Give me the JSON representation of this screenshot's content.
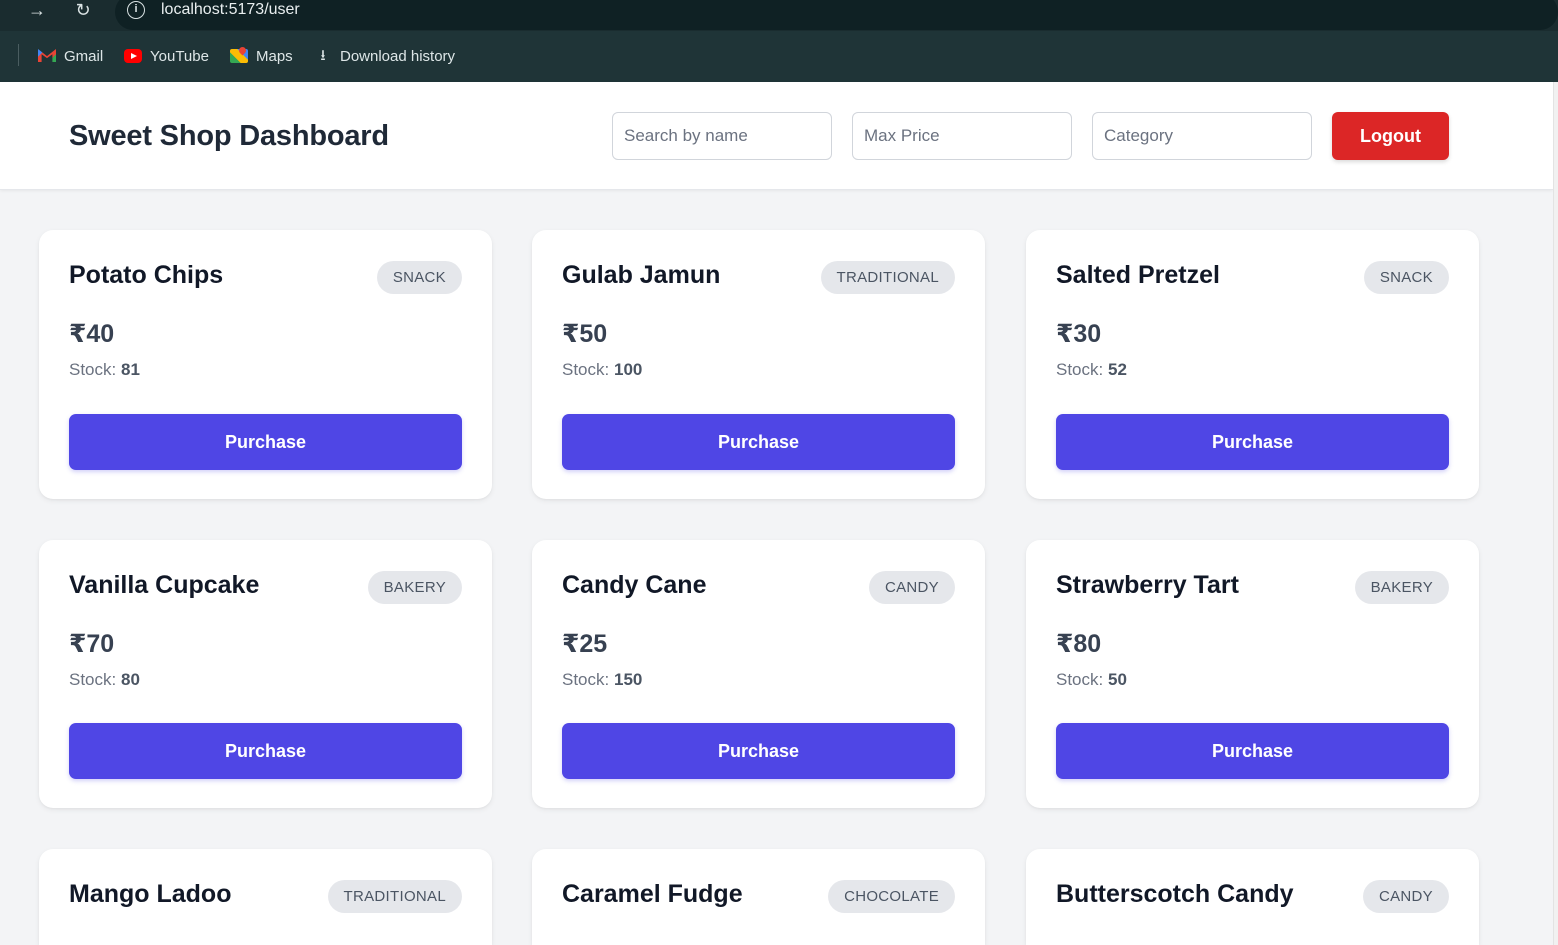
{
  "browser": {
    "url": "localhost:5173/user",
    "forward_glyph": "→",
    "reload_glyph": "↻",
    "info_glyph": "i",
    "download_glyph": "⭳",
    "bookmarks": [
      {
        "label": "Gmail",
        "icon": "gmail-icon"
      },
      {
        "label": "YouTube",
        "icon": "youtube-icon"
      },
      {
        "label": "Maps",
        "icon": "maps-icon"
      },
      {
        "label": "Download history",
        "icon": "download-icon"
      }
    ]
  },
  "header": {
    "title": "Sweet Shop Dashboard",
    "search_placeholder": "Search by name",
    "max_price_placeholder": "Max Price",
    "category_placeholder": "Category",
    "logout_label": "Logout"
  },
  "colors": {
    "accent": "#4f46e5",
    "danger": "#dc2626",
    "badge_bg": "#e5e7eb"
  },
  "sweets": [
    {
      "name": "Potato Chips",
      "category": "SNACK",
      "price": "₹40",
      "stock_label": "Stock:",
      "stock": "81",
      "action": "Purchase"
    },
    {
      "name": "Gulab Jamun",
      "category": "TRADITIONAL",
      "price": "₹50",
      "stock_label": "Stock:",
      "stock": "100",
      "action": "Purchase"
    },
    {
      "name": "Salted Pretzel",
      "category": "SNACK",
      "price": "₹30",
      "stock_label": "Stock:",
      "stock": "52",
      "action": "Purchase"
    },
    {
      "name": "Vanilla Cupcake",
      "category": "BAKERY",
      "price": "₹70",
      "stock_label": "Stock:",
      "stock": "80",
      "action": "Purchase"
    },
    {
      "name": "Candy Cane",
      "category": "CANDY",
      "price": "₹25",
      "stock_label": "Stock:",
      "stock": "150",
      "action": "Purchase"
    },
    {
      "name": "Strawberry Tart",
      "category": "BAKERY",
      "price": "₹80",
      "stock_label": "Stock:",
      "stock": "50",
      "action": "Purchase"
    },
    {
      "name": "Mango Ladoo",
      "category": "TRADITIONAL"
    },
    {
      "name": "Caramel Fudge",
      "category": "CHOCOLATE"
    },
    {
      "name": "Butterscotch Candy",
      "category": "CANDY"
    }
  ]
}
